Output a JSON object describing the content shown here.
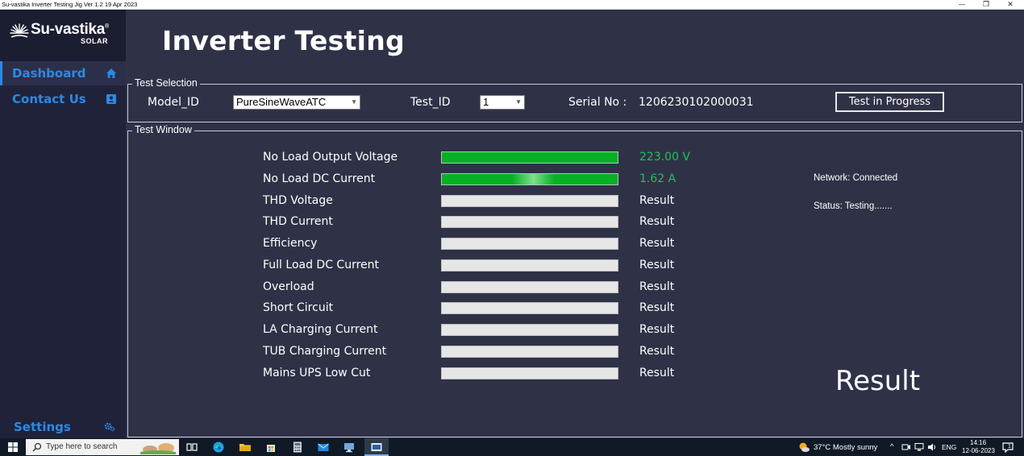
{
  "window": {
    "title": "Su-vastika Inverter Testing Jig Ver 1.2 19 Apr 2023",
    "minimize": "—",
    "restore": "❐",
    "close": "✕"
  },
  "sidebar": {
    "logo_text": "Su-vastika",
    "logo_reg": "®",
    "logo_sub": "SOLAR",
    "items": [
      {
        "label": "Dashboard",
        "icon": "home-icon"
      },
      {
        "label": "Contact Us",
        "icon": "contact-icon"
      }
    ],
    "settings_label": "Settings",
    "settings_icon": "gears-icon"
  },
  "main": {
    "title": "Inverter Testing",
    "test_selection": {
      "group_label": "Test Selection",
      "model_label": "Model_ID",
      "model_value": "PureSineWaveATC",
      "test_id_label": "Test_ID",
      "test_id_value": "1",
      "serial_label": "Serial No :",
      "serial_value": "1206230102000031",
      "progress_button": "Test in Progress"
    },
    "test_window": {
      "group_label": "Test Window",
      "tests": [
        {
          "name": "No Load Output Voltage",
          "value": "223.00 V",
          "progress": 1.0,
          "status": "pass"
        },
        {
          "name": "No Load DC Current",
          "value": "1.62 A",
          "progress": 1.0,
          "status": "running"
        },
        {
          "name": "THD Voltage",
          "value": "Result",
          "progress": 0,
          "status": "pending"
        },
        {
          "name": "THD Current",
          "value": "Result",
          "progress": 0,
          "status": "pending"
        },
        {
          "name": "Efficiency",
          "value": "Result",
          "progress": 0,
          "status": "pending"
        },
        {
          "name": "Full Load DC Current",
          "value": "Result",
          "progress": 0,
          "status": "pending"
        },
        {
          "name": "Overload",
          "value": "Result",
          "progress": 0,
          "status": "pending"
        },
        {
          "name": "Short Circuit",
          "value": "Result",
          "progress": 0,
          "status": "pending"
        },
        {
          "name": "LA Charging Current",
          "value": "Result",
          "progress": 0,
          "status": "pending"
        },
        {
          "name": "TUB Charging Current",
          "value": "Result",
          "progress": 0,
          "status": "pending"
        },
        {
          "name": "Mains UPS Low Cut",
          "value": "Result",
          "progress": 0,
          "status": "pending"
        }
      ],
      "network_status": "Network: Connected",
      "status_text": "Status: Testing.......",
      "big_result": "Result"
    }
  },
  "taskbar": {
    "search_placeholder": "Type here to search",
    "weather": "37°C  Mostly sunny",
    "language": "ENG",
    "time": "14:16",
    "date": "12-06-2023",
    "notification_count": "1"
  },
  "colors": {
    "background": "#2f3247",
    "sidebar": "#20223a",
    "accent": "#2b8ae6",
    "pass_green": "#06b025",
    "value_green": "#22c05a"
  }
}
